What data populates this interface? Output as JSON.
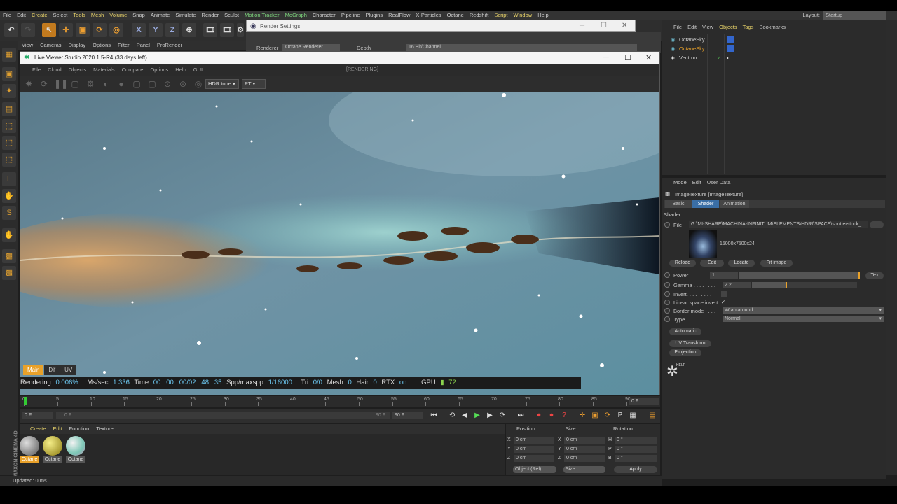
{
  "menubar": {
    "items": [
      "File",
      "Edit",
      "Create",
      "Select",
      "Tools",
      "Mesh",
      "Volume",
      "Snap",
      "Animate",
      "Simulate",
      "Render",
      "Sculpt",
      "Motion Tracker",
      "MoGraph",
      "Character",
      "Pipeline",
      "Plugins",
      "RealFlow",
      "X-Particles",
      "Octane",
      "Redshift",
      "Script",
      "Window",
      "Help"
    ],
    "layout_label": "Layout:",
    "layout_value": "Startup"
  },
  "toolbar": {
    "x": "X",
    "y": "Y",
    "z": "Z"
  },
  "viewbar": [
    "View",
    "Cameras",
    "Display",
    "Options",
    "Filter",
    "Panel",
    "ProRender"
  ],
  "render_settings": {
    "title": "Render Settings",
    "renderer_label": "Renderer",
    "renderer_value": "Octane Renderer",
    "depth_label": "Depth",
    "depth_value": "16 Bit/Channel"
  },
  "live_viewer": {
    "title": "Live Viewer Studio 2020.1.5-R4 (33 days left)",
    "menu": [
      "File",
      "Cloud",
      "Objects",
      "Materials",
      "Compare",
      "Options",
      "Help",
      "GUI"
    ],
    "status": "[RENDERING]",
    "tone": "HDR tone",
    "kernel": "PT",
    "passes": [
      "Main",
      "Dif",
      "UV"
    ],
    "stats": {
      "rendering_label": "Rendering:",
      "rendering_value": "0.006%",
      "ms_label": "Ms/sec:",
      "ms_value": "1.336",
      "time_label": "Time:",
      "time_value": "00 : 00 : 00/02 : 48 : 35",
      "spp_label": "Spp/maxspp:",
      "spp_value": "1/16000",
      "tri_label": "Tri:",
      "tri_value": "0/0",
      "mesh_label": "Mesh:",
      "mesh_value": "0",
      "hair_label": "Hair:",
      "hair_value": "0",
      "rtx_label": "RTX:",
      "rtx_value": "on",
      "gpu_label": "GPU:",
      "gpu_value": "72"
    }
  },
  "timeline": {
    "ticks": [
      "0",
      "5",
      "10",
      "15",
      "20",
      "25",
      "30",
      "35",
      "40",
      "45",
      "50",
      "55",
      "60",
      "65",
      "70",
      "75",
      "80",
      "85",
      "90"
    ],
    "frame_right": "0 F"
  },
  "transport": {
    "start": "0 F",
    "range_a": "0 F",
    "range_b": "90 F",
    "end": "90 F"
  },
  "materials": {
    "menu": [
      "Create",
      "Edit",
      "Function",
      "Texture"
    ],
    "items": [
      "Octane",
      "Octane",
      "Octane"
    ]
  },
  "coords": {
    "position": "Position",
    "size": "Size",
    "rotation": "Rotation",
    "x": "X",
    "y": "Y",
    "z": "Z",
    "h": "H",
    "p": "P",
    "b": "B",
    "val_cm": "0 cm",
    "val_deg": "0 °",
    "mode": "Object (Rel)",
    "size_mode": "Size",
    "apply": "Apply"
  },
  "objects": {
    "menu": [
      "File",
      "Edit",
      "View",
      "Objects",
      "Tags",
      "Bookmarks"
    ],
    "rows": [
      "OctaneSky",
      "OctaneSky",
      "Vectron"
    ]
  },
  "attributes": {
    "menu": [
      "Mode",
      "Edit",
      "User Data"
    ],
    "object": "ImageTexture [ImageTexture]",
    "tabs": [
      "Basic",
      "Shader",
      "Animation"
    ],
    "section": "Shader",
    "file_label": "File",
    "file_path": "G:\\MI-SHARE\\MACHINA-INFINITUM\\ELEMENTS\\HDRI\\SPACE\\shutterstock_",
    "file_btn": "...",
    "img_size": "15000x7500x24",
    "buttons": [
      "Reload",
      "Edit",
      "Locate",
      "Fit image"
    ],
    "power_label": "Power",
    "power_val": "1.",
    "power_fraction": 0.99,
    "tex": "Tex",
    "gamma_label": "Gamma . . . . . . . .",
    "gamma_val": "2.2",
    "gamma_fraction": 0.33,
    "invert_label": "Invert. . . . . . . . .",
    "linear_label": "Linear space invert",
    "linear_check": "✓",
    "border_label": "Border mode . . . .",
    "border_val": "Wrap around",
    "type_label": "Type . . . . . . . . . .",
    "type_val": "Normal",
    "automatic": "Automatic",
    "uv_transform": "UV Transform",
    "projection": "Projection",
    "help": "HELP"
  },
  "statusbar": "Updated: 0 ms.",
  "maxon": "MAXON CINEMA 4D"
}
